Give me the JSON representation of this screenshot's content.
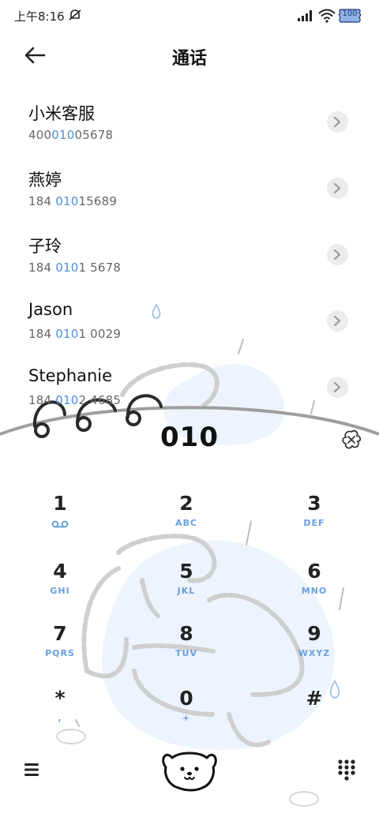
{
  "status_bar": {
    "time": "上午8:16",
    "battery": "100"
  },
  "header": {
    "title": "通话"
  },
  "contacts": [
    {
      "name": "小米客服",
      "number_before": "400",
      "number_match": "010",
      "number_after": "05678"
    },
    {
      "name": "燕婷",
      "number_before": "184 ",
      "number_match": "010",
      "number_after": "15689"
    },
    {
      "name": "子玲",
      "number_before": "184 ",
      "number_match": "010",
      "number_after": "1 5678"
    },
    {
      "name": "Jason",
      "number_before": "184 ",
      "number_match": "010",
      "number_after": "1 0029"
    },
    {
      "name": "Stephanie",
      "number_before": "184 ",
      "number_match": "010",
      "number_after": "2 4685"
    }
  ],
  "dialer": {
    "entered": "010",
    "keys": [
      {
        "digit": "1",
        "letters": ""
      },
      {
        "digit": "2",
        "letters": "ABC"
      },
      {
        "digit": "3",
        "letters": "DEF"
      },
      {
        "digit": "4",
        "letters": "GHI"
      },
      {
        "digit": "5",
        "letters": "JKL"
      },
      {
        "digit": "6",
        "letters": "MNO"
      },
      {
        "digit": "7",
        "letters": "PQRS"
      },
      {
        "digit": "8",
        "letters": "TUV"
      },
      {
        "digit": "9",
        "letters": "WXYZ"
      },
      {
        "digit": "*",
        "letters": ","
      },
      {
        "digit": "0",
        "letters": "+"
      },
      {
        "digit": "#",
        "letters": ""
      }
    ]
  },
  "colors": {
    "accent": "#4f8fda",
    "key_letters": "#6aa0dc",
    "highlight_bg": "#eef4fd"
  },
  "icons": {
    "back": "arrow-left-icon",
    "clear": "backspace-icon",
    "menu": "hamburger-menu-icon",
    "call": "dog-face-icon",
    "pad": "dialpad-icon",
    "voicemail": "voicemail-icon"
  }
}
